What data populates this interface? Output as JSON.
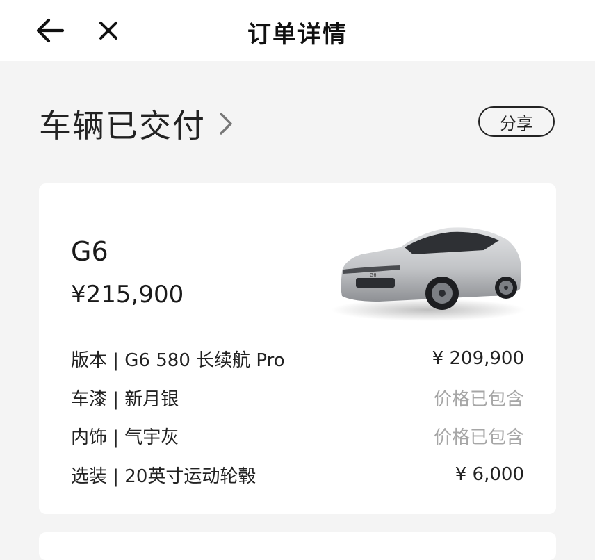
{
  "header": {
    "title": "订单详情",
    "back_icon": "arrow-left-icon",
    "close_icon": "close-icon"
  },
  "status": {
    "text": "车辆已交付",
    "chevron_icon": "chevron-right-icon",
    "share_label": "分享"
  },
  "order": {
    "model": "G6",
    "total_price": "¥215,900",
    "car_image": "car-image",
    "items": [
      {
        "label": "版本 | G6 580 长续航 Pro",
        "value": "¥ 209,900",
        "muted": false
      },
      {
        "label": "车漆 | 新月银",
        "value": "价格已包含",
        "muted": true
      },
      {
        "label": "内饰 | 气宇灰",
        "value": "价格已包含",
        "muted": true
      },
      {
        "label": "选装 | 20英寸运动轮毂",
        "value": "¥ 6,000",
        "muted": false
      }
    ]
  },
  "colors": {
    "background": "#f4f4f4",
    "card": "#ffffff",
    "text": "#1a1a1a",
    "muted": "#a6a6a6"
  }
}
